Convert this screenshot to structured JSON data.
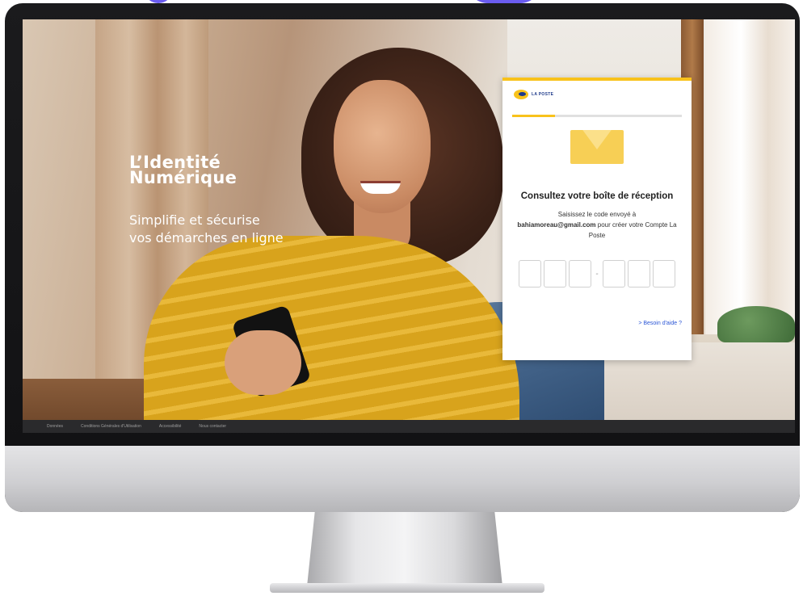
{
  "hero": {
    "title_line1": "L’Identité",
    "title_line2": "Numérique",
    "subtitle_line1": "Simplifie et sécurise",
    "subtitle_line2": "vos démarches en ligne"
  },
  "card": {
    "logo_text": "LA POSTE",
    "progress_fraction": 0.25,
    "icon": "envelope-icon",
    "title": "Consultez votre boîte de réception",
    "text_before": "Saisissez le code envoyé à",
    "email": "bahiamoreau@gmail.com",
    "text_after": "pour créer votre Compte La Poste",
    "code_separator": "-",
    "help_link": "> Besoin d'aide ?"
  },
  "footer": {
    "links": [
      "Données",
      "Conditions Générales d'Utilisation",
      "Accessibilité",
      "Nous contacter"
    ]
  },
  "colors": {
    "accent_yellow": "#f8c21b",
    "link_blue": "#2b56d6",
    "brand_blue": "#1e3a8a"
  }
}
